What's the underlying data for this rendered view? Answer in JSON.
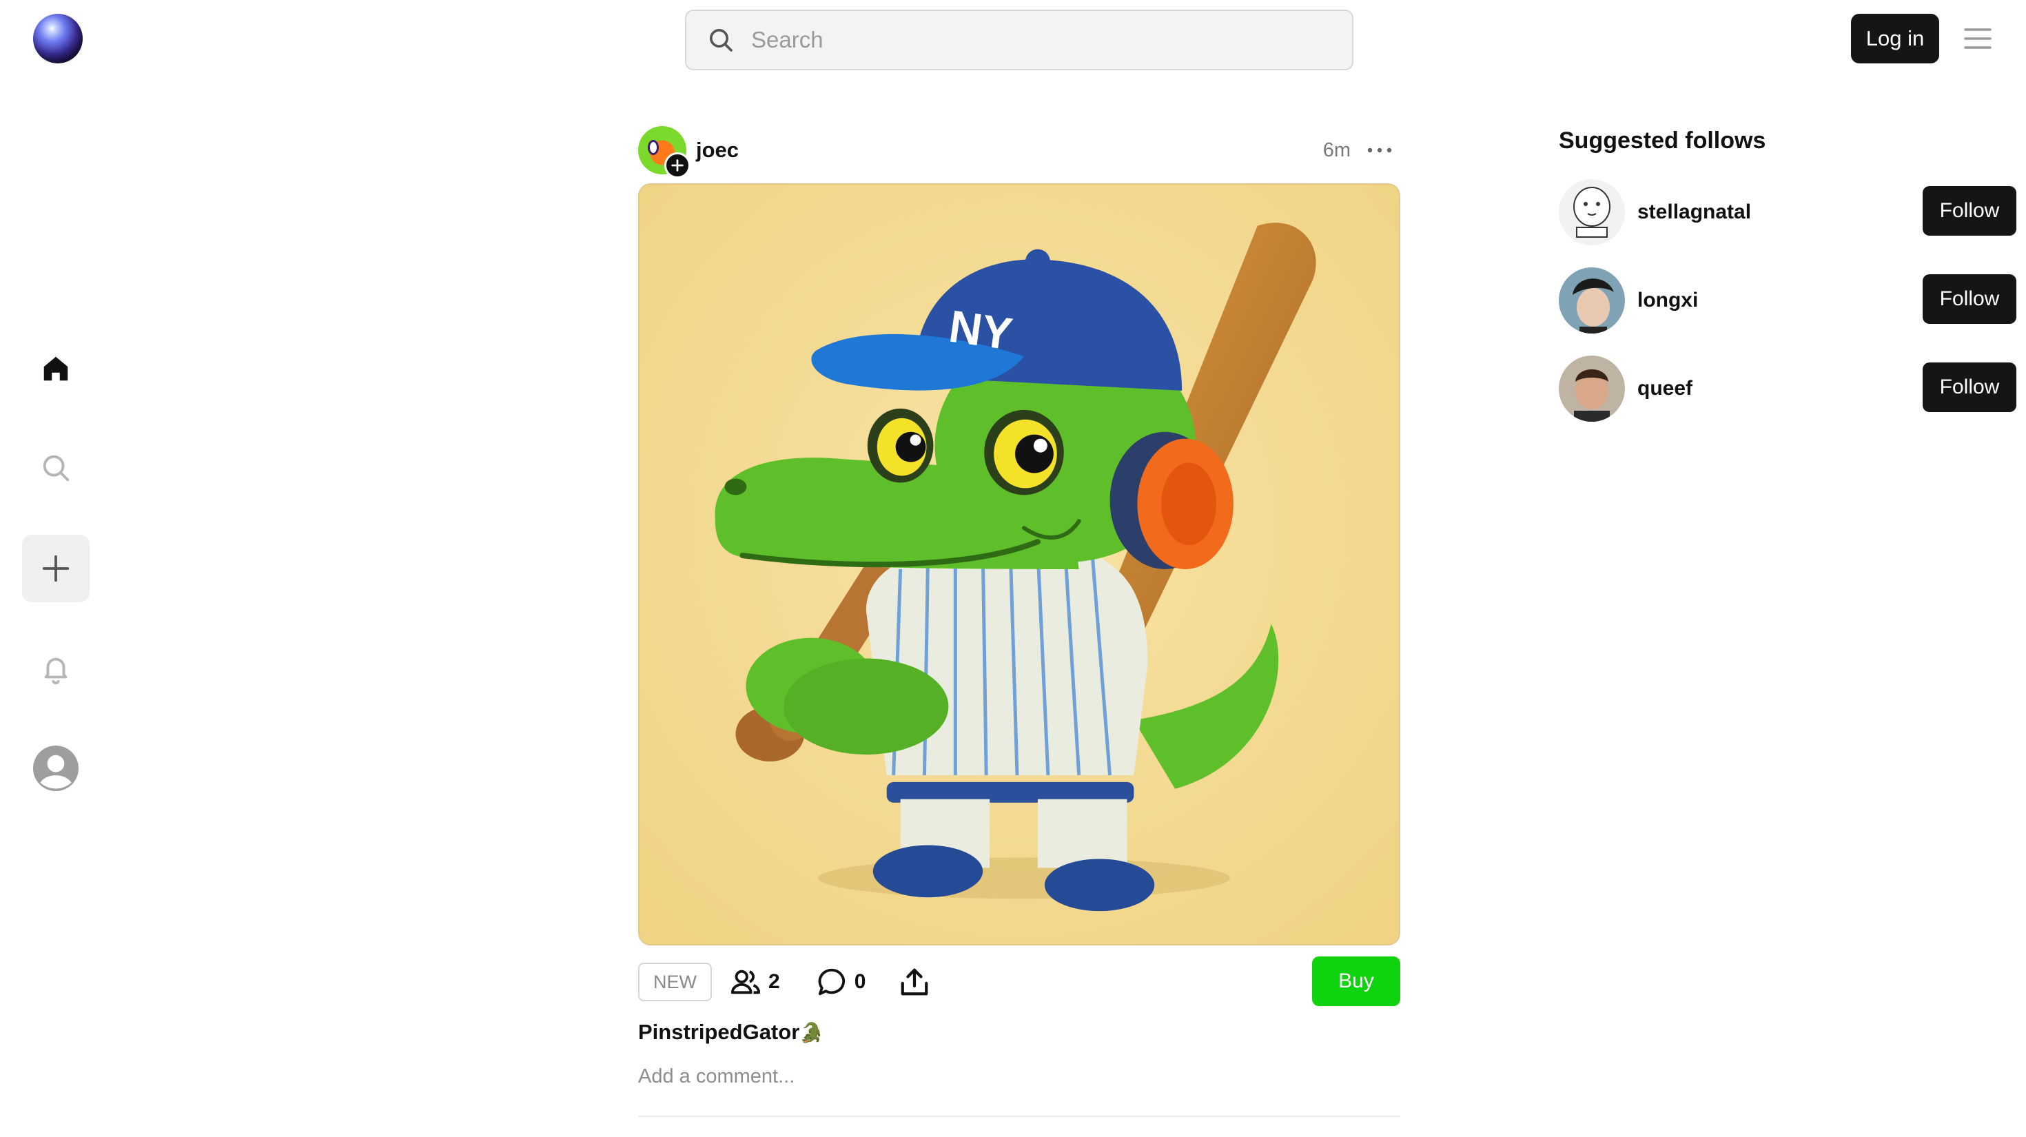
{
  "header": {
    "logo": "orb-logo",
    "search_placeholder": "Search",
    "login_label": "Log in",
    "menu_icon": "hamburger-menu-icon"
  },
  "sidebar": {
    "items": [
      {
        "id": "home",
        "icon": "home-icon",
        "active": true
      },
      {
        "id": "search",
        "icon": "search-icon",
        "active": false
      },
      {
        "id": "create",
        "icon": "plus-icon",
        "active": false
      },
      {
        "id": "notifications",
        "icon": "bell-icon",
        "active": false
      },
      {
        "id": "profile",
        "icon": "user-avatar-icon",
        "active": false
      }
    ]
  },
  "post": {
    "username": "joec",
    "time": "6m",
    "more_icon": "ellipsis-icon",
    "image_subject": "cartoon green alligator in NY baseball cap and pinstriped uniform holding a bat",
    "cap_text": "NY",
    "badge": "NEW",
    "collectors_count": "2",
    "comments_count": "0",
    "buy_label": "Buy",
    "caption": "PinstripedGator",
    "caption_emoji": "🐊",
    "comment_placeholder": "Add a comment...",
    "colors": {
      "buy": "#10d310",
      "image_bg": "#f3d98f"
    }
  },
  "suggested": {
    "title": "Suggested follows",
    "follow_label": "Follow",
    "users": [
      {
        "name": "stellagnatal"
      },
      {
        "name": "longxi"
      },
      {
        "name": "queef"
      }
    ]
  }
}
